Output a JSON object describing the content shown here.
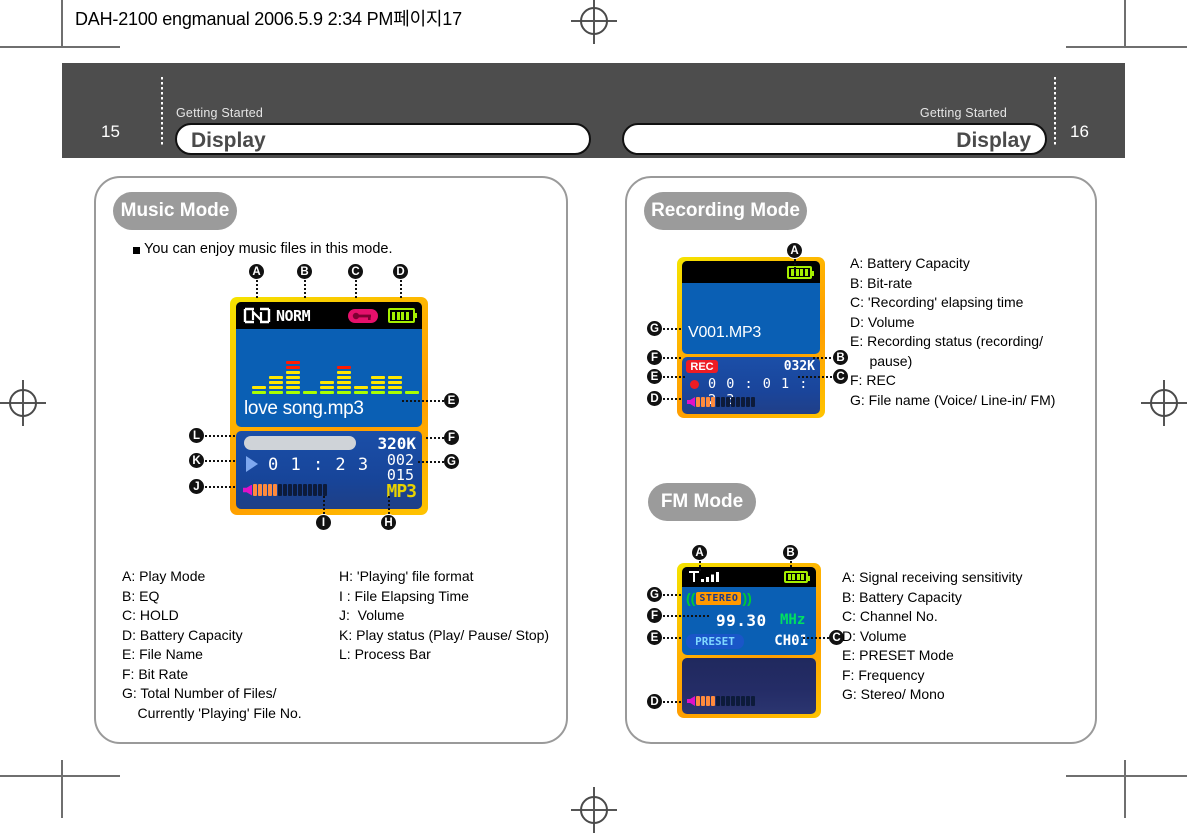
{
  "print_header": "DAH-2100 engmanual  2006.5.9 2:34 PM페이지17",
  "header": {
    "left": {
      "page": "15",
      "kicker": "Getting Started",
      "title": "Display"
    },
    "right": {
      "page": "16",
      "kicker": "Getting Started",
      "title": "Display"
    }
  },
  "music": {
    "badge": "Music Mode",
    "intro": "You can enjoy music files in this mode.",
    "screen": {
      "play_mode_icon": "play-mode-icon",
      "eq": "NORM",
      "hold_icon": "hold-key-icon",
      "battery_icon": "battery-icon",
      "file_name": "love song.mp3",
      "bitrate": "320K",
      "elapsed": "0 1 : 2 3",
      "track_current": "002",
      "track_total": "015",
      "format": "MP3",
      "play_icon": "play-triangle-icon"
    },
    "callouts": [
      "A",
      "B",
      "C",
      "D",
      "E",
      "F",
      "G",
      "H",
      "I",
      "J",
      "K",
      "L"
    ],
    "legend_left": [
      "A: Play Mode",
      "B: EQ",
      "C: HOLD",
      "D: Battery Capacity",
      "E: File Name",
      "F: Bit Rate",
      "G: Total Number of Files/",
      "    Currently 'Playing' File No."
    ],
    "legend_right": [
      "H: 'Playing' file format",
      "I : File Elapsing Time",
      "J:  Volume",
      "K: Play status (Play/ Pause/ Stop)",
      "L: Process Bar"
    ]
  },
  "recording": {
    "badge": "Recording Mode",
    "screen": {
      "battery_icon": "battery-icon",
      "file_name": "V001.MP3",
      "rec_badge": "REC",
      "bitrate": "032K",
      "elapsed": "0 0 : 0 1 : 2 3",
      "rec_dot_icon": "record-dot-icon"
    },
    "callouts": [
      "A",
      "B",
      "C",
      "D",
      "E",
      "F",
      "G"
    ],
    "legend": [
      "A: Battery Capacity",
      "B: Bit-rate",
      "C: 'Recording' elapsing time",
      "D: Volume",
      "E: Recording status (recording/",
      "     pause)",
      "F: REC",
      "G: File name (Voice/ Line-in/ FM)"
    ]
  },
  "fm": {
    "badge": "FM Mode",
    "screen": {
      "signal_icon": "signal-strength-icon",
      "battery_icon": "battery-icon",
      "stereo": "STEREO",
      "frequency": "99.30",
      "unit": "MHz",
      "preset": "PRESET",
      "channel": "CH01"
    },
    "callouts": [
      "A",
      "B",
      "C",
      "D",
      "E",
      "F",
      "G"
    ],
    "legend": [
      "A: Signal receiving sensitivity",
      "B: Battery Capacity",
      "C: Channel No.",
      "D: Volume",
      "E: PRESET Mode",
      "F: Frequency",
      "G: Stereo/ Mono"
    ]
  },
  "colors": {
    "header_bar": "#4d4d4d",
    "pill": "#9b9b9b",
    "lcd_blue": "#0a5fb4",
    "lcd_bezel": "#ffb200",
    "rec_red": "#ee1c24",
    "stereo_orange": "#ff9900",
    "preset_blue": "#1a56c8",
    "battery_green": "#a6f000"
  }
}
